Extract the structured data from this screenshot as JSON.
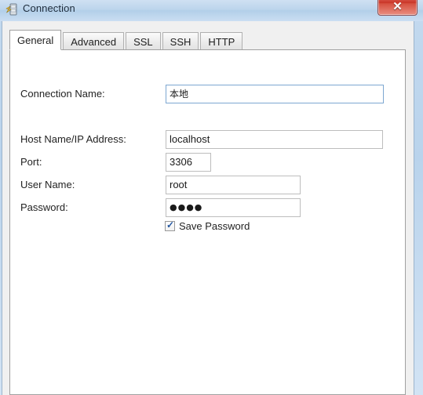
{
  "window": {
    "title": "Connection",
    "icon": "connection-server-icon",
    "close_label": "✕"
  },
  "tabs": [
    {
      "label": "General",
      "active": true
    },
    {
      "label": "Advanced",
      "active": false
    },
    {
      "label": "SSL",
      "active": false
    },
    {
      "label": "SSH",
      "active": false
    },
    {
      "label": "HTTP",
      "active": false
    }
  ],
  "form": {
    "connection_name": {
      "label": "Connection Name:",
      "value": "本地",
      "placeholder": ""
    },
    "host": {
      "label": "Host Name/IP Address:",
      "value": "localhost",
      "placeholder": ""
    },
    "port": {
      "label": "Port:",
      "value": "3306",
      "placeholder": ""
    },
    "user_name": {
      "label": "User Name:",
      "value": "root",
      "placeholder": ""
    },
    "password": {
      "label": "Password:",
      "value": "●●●●",
      "placeholder": ""
    },
    "save_password": {
      "label": "Save Password",
      "checked": true,
      "check_glyph": "✓"
    }
  },
  "colors": {
    "titlebar": "#bcd5ec",
    "close_button": "#c93527",
    "focus_border": "#7da7d1",
    "field_border": "#bdbdbd",
    "panel_bg": "#ffffff",
    "dialog_bg": "#f0f0f0",
    "check_mark": "#2457a0"
  }
}
